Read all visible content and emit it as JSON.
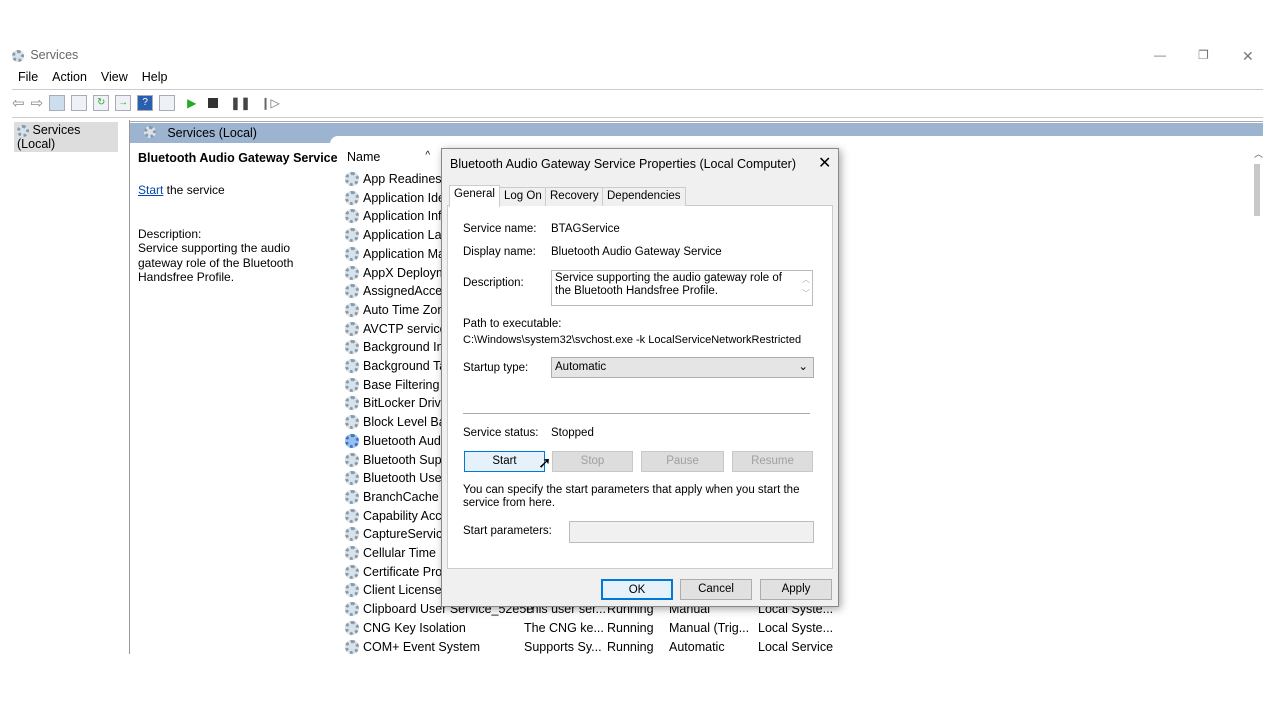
{
  "window": {
    "title": "Services",
    "min": "—",
    "max": "❐",
    "close": "✕"
  },
  "menu": [
    "File",
    "Action",
    "View",
    "Help"
  ],
  "tree": {
    "root": "Services (Local)"
  },
  "header": {
    "title": "Services (Local)"
  },
  "detail": {
    "service": "Bluetooth Audio Gateway Service",
    "start_link": "Start",
    "start_rest": " the service",
    "desc_label": "Description:",
    "desc": "Service supporting the audio gateway role of the Bluetooth Handsfree Profile."
  },
  "list": {
    "col_name": "Name",
    "rows": [
      {
        "name": "App Readiness"
      },
      {
        "name": "Application Ide"
      },
      {
        "name": "Application Inf"
      },
      {
        "name": "Application Lay"
      },
      {
        "name": "Application Ma"
      },
      {
        "name": "AppX Deploym"
      },
      {
        "name": "AssignedAcces"
      },
      {
        "name": "Auto Time Zon"
      },
      {
        "name": "AVCTP service"
      },
      {
        "name": "Background Int"
      },
      {
        "name": "Background Ta"
      },
      {
        "name": "Base Filtering E"
      },
      {
        "name": "BitLocker Drive"
      },
      {
        "name": "Block Level Bac"
      },
      {
        "name": "Bluetooth Audi"
      },
      {
        "name": "Bluetooth Supp"
      },
      {
        "name": "Bluetooth User"
      },
      {
        "name": "BranchCache"
      },
      {
        "name": "Capability Acce"
      },
      {
        "name": "CaptureService_"
      },
      {
        "name": "Cellular Time"
      },
      {
        "name": "Certificate Prop"
      },
      {
        "name": "Client License S"
      },
      {
        "name": "Clipboard User Service_52e5e",
        "desc": "This user ser...",
        "status": "Running",
        "startup": "Manual",
        "logon": "Local Syste..."
      },
      {
        "name": "CNG Key Isolation",
        "desc": "The CNG ke...",
        "status": "Running",
        "startup": "Manual (Trig...",
        "logon": "Local Syste..."
      },
      {
        "name": "COM+ Event System",
        "desc": "Supports Sy...",
        "status": "Running",
        "startup": "Automatic",
        "logon": "Local Service"
      }
    ]
  },
  "dialog": {
    "title": "Bluetooth Audio Gateway Service Properties (Local Computer)",
    "tabs": [
      "General",
      "Log On",
      "Recovery",
      "Dependencies"
    ],
    "service_name_label": "Service name:",
    "service_name": "BTAGService",
    "display_name_label": "Display name:",
    "display_name": "Bluetooth Audio Gateway Service",
    "description_label": "Description:",
    "description": "Service supporting the audio gateway role of the Bluetooth Handsfree Profile.",
    "path_label": "Path to executable:",
    "path": "C:\\Windows\\system32\\svchost.exe -k LocalServiceNetworkRestricted",
    "startup_label": "Startup type:",
    "startup": "Automatic",
    "status_label": "Service status:",
    "status": "Stopped",
    "start": "Start",
    "stop": "Stop",
    "pause": "Pause",
    "resume": "Resume",
    "hint": "You can specify the start parameters that apply when you start the service from here.",
    "params_label": "Start parameters:",
    "params": "",
    "ok": "OK",
    "cancel": "Cancel",
    "apply": "Apply"
  }
}
